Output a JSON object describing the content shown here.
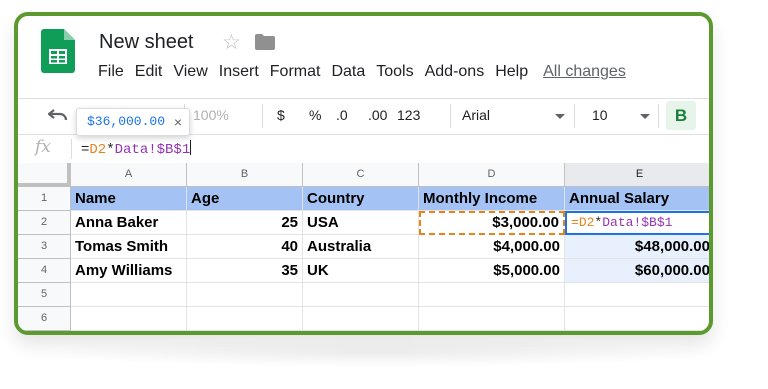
{
  "doc": {
    "title": "New sheet"
  },
  "menu": [
    "File",
    "Edit",
    "View",
    "Insert",
    "Format",
    "Data",
    "Tools",
    "Add-ons",
    "Help"
  ],
  "menu_changes": "All changes",
  "toolbar": {
    "zoom": "100%",
    "currency": "$",
    "percent": "%",
    "decrease_decimal": ".0",
    "increase_decimal": ".00",
    "format_more": "123",
    "font": "Arial",
    "font_size": "10",
    "bold": "B"
  },
  "tooltip": {
    "value": "$36,000.00",
    "close": "×"
  },
  "formula_bar": {
    "fx": "fx",
    "eq": "=",
    "ref": "D2",
    "op": "*",
    "range": "Data!$B$1"
  },
  "grid": {
    "columns": [
      "A",
      "B",
      "C",
      "D",
      "E"
    ],
    "row_numbers": [
      "1",
      "2",
      "3",
      "4",
      "5",
      "6"
    ],
    "header_row": [
      "Name",
      "Age",
      "Country",
      "Monthly Income",
      "Annual Salary"
    ],
    "rows": [
      [
        "Anna Baker",
        "25",
        "USA",
        "$3,000.00",
        ""
      ],
      [
        "Tomas Smith",
        "40",
        "Australia",
        "$4,000.00",
        "$48,000.00"
      ],
      [
        "Amy Williams",
        "35",
        "UK",
        "$5,000.00",
        "$60,000.00"
      ]
    ]
  },
  "colors": {
    "frame": "#5c9a2f",
    "header_fill": "#a4c2f4",
    "active_border": "#1a73e8",
    "reference": "#e8821a",
    "range_ref": "#9334b3",
    "selection_fill": "#e8f0fe"
  }
}
